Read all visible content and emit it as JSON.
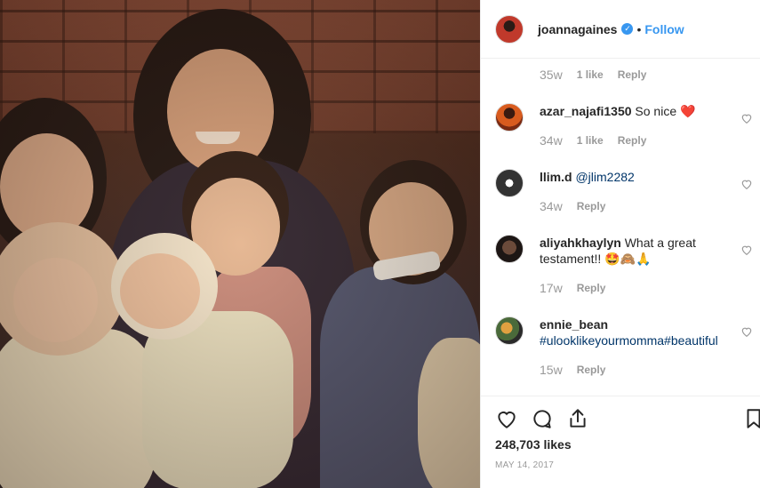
{
  "post": {
    "username": "joannagaines",
    "follow_label": "Follow",
    "dot": "•",
    "likes_count": "248,703 likes",
    "date": "MAY 14, 2017"
  },
  "top_meta": {
    "time": "35w",
    "likes": "1 like",
    "reply": "Reply"
  },
  "comments": [
    {
      "user": "azar_najafi1350",
      "text": "So nice",
      "emoji": "❤️",
      "time": "34w",
      "likes": "1 like",
      "reply": "Reply"
    },
    {
      "user": "llim.d",
      "text": "@jlim2282",
      "time": "34w",
      "reply": "Reply"
    },
    {
      "user": "aliyahkhaylyn",
      "text": "What a great testament!! ",
      "emoji": "🤩🙈🙏",
      "time": "17w",
      "reply": "Reply"
    },
    {
      "user": "ennie_bean",
      "text": "#ulooklikeyourmomma#beautiful",
      "time": "15w",
      "reply": "Reply"
    }
  ],
  "icons": {
    "like": "heart-icon",
    "comment": "comment-icon",
    "share": "share-icon",
    "save": "bookmark-icon"
  },
  "colors": {
    "link": "#3897f0",
    "muted": "#999999",
    "heart_red": "#e0102a"
  }
}
